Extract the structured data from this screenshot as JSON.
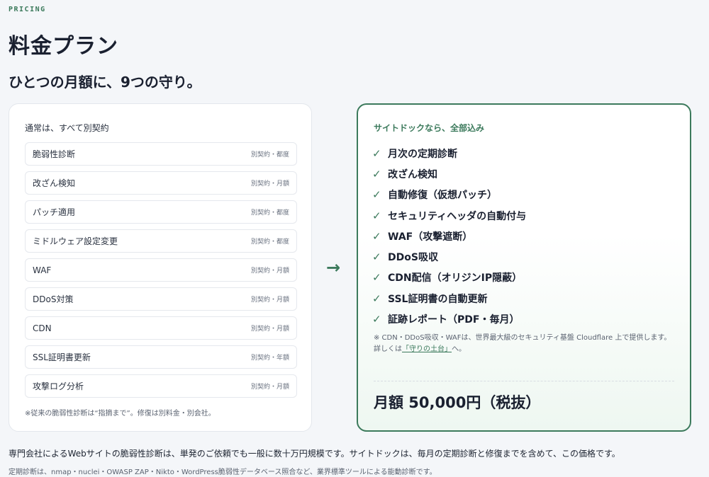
{
  "eyebrow": "PRICING",
  "title": "料金プラン",
  "subtitle": "ひとつの月額に、9つの守り。",
  "left_card": {
    "heading": "通常は、すべて別契約",
    "items": [
      {
        "name": "脆弱性診断",
        "tag": "別契約・都度"
      },
      {
        "name": "改ざん検知",
        "tag": "別契約・月額"
      },
      {
        "name": "パッチ適用",
        "tag": "別契約・都度"
      },
      {
        "name": "ミドルウェア設定変更",
        "tag": "別契約・都度"
      },
      {
        "name": "WAF",
        "tag": "別契約・月額"
      },
      {
        "name": "DDoS対策",
        "tag": "別契約・月額"
      },
      {
        "name": "CDN",
        "tag": "別契約・月額"
      },
      {
        "name": "SSL証明書更新",
        "tag": "別契約・年額"
      },
      {
        "name": "攻撃ログ分析",
        "tag": "別契約・月額"
      }
    ],
    "note": "※従来の脆弱性診断は“指摘まで”。修復は別料金・別会社。"
  },
  "arrow": "→",
  "right_card": {
    "heading": "サイトドックなら、全部込み",
    "check_glyph": "✓",
    "features": [
      "月次の定期診断",
      "改ざん検知",
      "自動修復（仮想パッチ）",
      "セキュリティヘッダの自動付与",
      "WAF（攻撃遮断）",
      "DDoS吸収",
      "CDN配信（オリジンIP隠蔽）",
      "SSL証明書の自動更新",
      "証跡レポート（PDF・毎月）"
    ],
    "note_line1": "※ CDN・DDoS吸収・WAFは、世界最大級のセキュリティ基盤 Cloudflare 上で提供します。",
    "note_line2_prefix": "詳しくは",
    "note_link": "「守りの土台」",
    "note_line2_suffix": "へ。",
    "price": "月額 50,000円（税抜）"
  },
  "footer": {
    "main": "専門会社によるWebサイトの脆弱性診断は、単発のご依頼でも一般に数十万円規模です。サイトドックは、毎月の定期診断と修復までを含めて、この価格です。",
    "sub": "定期診断は、nmap・nuclei・OWASP ZAP・Nikto・WordPress脆弱性データベース照合など、業界標準ツールによる能動診断です。"
  },
  "colors": {
    "accent": "#3c7a5c",
    "background": "#f4f6f9",
    "text": "#1a2030"
  }
}
